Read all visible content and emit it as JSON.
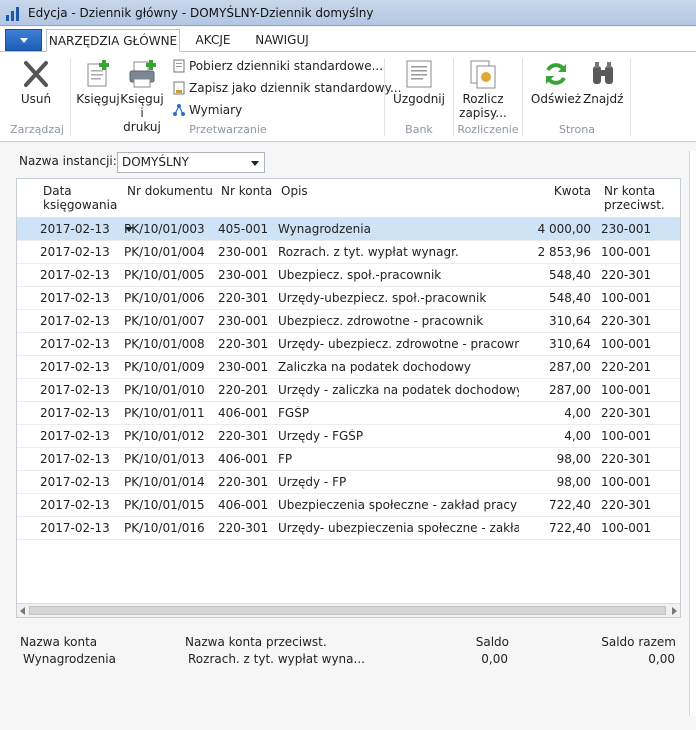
{
  "window": {
    "title": "Edycja - Dziennik główny - DOMYŚLNY-Dziennik domyślny"
  },
  "tabs": [
    "NARZĘDZIA GŁÓWNE",
    "AKCJE",
    "NAWIGUJ"
  ],
  "ribbon": {
    "delete": "Usuń",
    "post": "Księguj",
    "post_print_1": "Księguj",
    "post_print_2": "i drukuj",
    "get_standard": "Pobierz dzienniki standardowe...",
    "save_standard": "Zapisz jako dziennik standardowy...",
    "dimensions": "Wymiary",
    "reconcile": "Uzgodnij",
    "apply_1": "Rozlicz",
    "apply_2": "zapisy...",
    "refresh": "Odśwież",
    "find": "Znajdź",
    "groups": {
      "manage": "Zarządzaj",
      "process": "Przetwarzanie",
      "bank": "Bank",
      "apply": "Rozliczenie",
      "page": "Strona"
    }
  },
  "instance": {
    "label": "Nazwa instancji:",
    "value": "DOMYŚLNY"
  },
  "columns": {
    "date_1": "Data",
    "date_2": "księgowania",
    "doc": "Nr dokumentu",
    "account": "Nr konta",
    "desc": "Opis",
    "amount": "Kwota",
    "bal_1": "Nr konta",
    "bal_2": "przeciwst."
  },
  "rows": [
    {
      "date": "2017-02-13",
      "doc": "PK/10/01/003",
      "account": "405-001",
      "desc": "Wynagrodzenia",
      "amount": "4 000,00",
      "bal": "230-001"
    },
    {
      "date": "2017-02-13",
      "doc": "PK/10/01/004",
      "account": "230-001",
      "desc": "Rozrach. z tyt. wypłat wynagr.",
      "amount": "2 853,96",
      "bal": "100-001"
    },
    {
      "date": "2017-02-13",
      "doc": "PK/10/01/005",
      "account": "230-001",
      "desc": "Ubezpiecz. społ.-pracownik",
      "amount": "548,40",
      "bal": "220-301"
    },
    {
      "date": "2017-02-13",
      "doc": "PK/10/01/006",
      "account": "220-301",
      "desc": "Urzędy-ubezpiecz. społ.-pracownik",
      "amount": "548,40",
      "bal": "100-001"
    },
    {
      "date": "2017-02-13",
      "doc": "PK/10/01/007",
      "account": "230-001",
      "desc": "Ubezpiecz. zdrowotne - pracownik",
      "amount": "310,64",
      "bal": "220-301"
    },
    {
      "date": "2017-02-13",
      "doc": "PK/10/01/008",
      "account": "220-301",
      "desc": "Urzędy- ubezpiecz. zdrowotne - pracownik",
      "amount": "310,64",
      "bal": "100-001"
    },
    {
      "date": "2017-02-13",
      "doc": "PK/10/01/009",
      "account": "230-001",
      "desc": "Zaliczka na podatek dochodowy",
      "amount": "287,00",
      "bal": "220-201"
    },
    {
      "date": "2017-02-13",
      "doc": "PK/10/01/010",
      "account": "220-201",
      "desc": "Urzędy - zaliczka na podatek dochodowy",
      "amount": "287,00",
      "bal": "100-001"
    },
    {
      "date": "2017-02-13",
      "doc": "PK/10/01/011",
      "account": "406-001",
      "desc": "FGŚP",
      "amount": "4,00",
      "bal": "220-301"
    },
    {
      "date": "2017-02-13",
      "doc": "PK/10/01/012",
      "account": "220-301",
      "desc": "Urzędy - FGŚP",
      "amount": "4,00",
      "bal": "100-001"
    },
    {
      "date": "2017-02-13",
      "doc": "PK/10/01/013",
      "account": "406-001",
      "desc": "FP",
      "amount": "98,00",
      "bal": "220-301"
    },
    {
      "date": "2017-02-13",
      "doc": "PK/10/01/014",
      "account": "220-301",
      "desc": "Urzędy - FP",
      "amount": "98,00",
      "bal": "100-001"
    },
    {
      "date": "2017-02-13",
      "doc": "PK/10/01/015",
      "account": "406-001",
      "desc": "Ubezpieczenia społeczne - zakład pracy",
      "amount": "722,40",
      "bal": "220-301"
    },
    {
      "date": "2017-02-13",
      "doc": "PK/10/01/016",
      "account": "220-301",
      "desc": "Urzędy- ubezpieczenia społeczne - zakład pr...",
      "amount": "722,40",
      "bal": "100-001"
    }
  ],
  "footer": {
    "account_name_label": "Nazwa konta",
    "bal_name_label": "Nazwa konta przeciwst.",
    "balance_label": "Saldo",
    "total_label": "Saldo razem",
    "account_name": "Wynagrodzenia",
    "bal_name": "Rozrach. z tyt. wypłat wyna...",
    "balance": "0,00",
    "total": "0,00"
  },
  "colors": {
    "selection": "#cfe3f7",
    "accent": "#1d5fb8",
    "green_plus": "#3aa335"
  }
}
